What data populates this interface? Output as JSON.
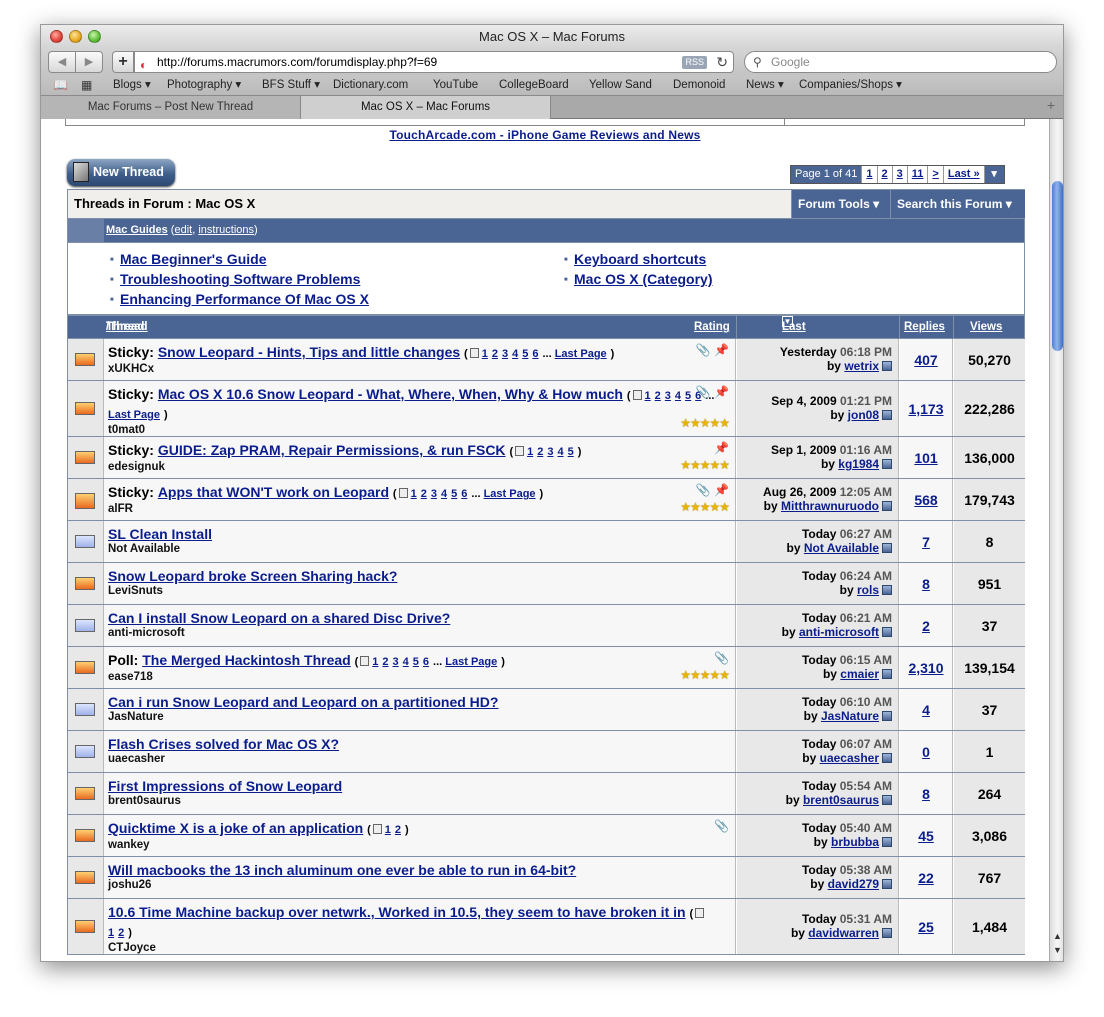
{
  "window": {
    "title": "Mac OS X – Mac Forums"
  },
  "toolbar": {
    "url": "http://forums.macrumors.com/forumdisplay.php?f=69",
    "rss": "RSS",
    "search_placeholder": "Google"
  },
  "bookmarks": [
    "Blogs ▾",
    "Photography ▾",
    "BFS Stuff ▾",
    "Dictionary.com",
    "YouTube",
    "CollegeBoard",
    "Yellow Sand",
    "Demonoid",
    "News ▾",
    "Companies/Shops ▾"
  ],
  "tabs": [
    "Mac Forums – Post New Thread",
    "Mac OS X – Mac Forums"
  ],
  "page": {
    "touch_link": "TouchArcade.com - iPhone Game Reviews and News",
    "new_thread": "New Thread",
    "pager": {
      "label": "Page 1 of 41",
      "pages": [
        "1",
        "2",
        "3",
        "11",
        ">",
        "Last »"
      ]
    },
    "forum_title": "Threads in Forum : Mac OS X",
    "forum_tools": "Forum Tools ▾",
    "search_forum": "Search this Forum ▾",
    "guides": {
      "title": "Mac Guides",
      "edit": "edit",
      "instructions": "instructions",
      "left": [
        "Mac Beginner's Guide",
        "Troubleshooting Software Problems",
        "Enhancing Performance Of Mac OS X"
      ],
      "right": [
        "Keyboard shortcuts",
        "Mac OS X (Category)"
      ]
    },
    "columns": {
      "thread": "Thread",
      "starter": "Thread Starter",
      "rating": "Rating",
      "last_post": "Last Post",
      "replies": "Replies",
      "views": "Views"
    }
  },
  "threads": [
    {
      "prefix": "Sticky:",
      "title": "Snow Leopard - Hints, Tips and little changes",
      "pages": "1 2 3 4 5 6",
      "last_page": "Last Page",
      "starter": "xUKHCx",
      "date": "Yesterday",
      "time": "06:18 PM",
      "by": "wetrix",
      "replies": "407",
      "views": "50,270",
      "icon": "hot",
      "marks": "📎 📌",
      "rating": ""
    },
    {
      "prefix": "Sticky:",
      "title": "Mac OS X 10.6 Snow Leopard - What, Where, When, Why & How much",
      "pages": "1 2 3 4 5 6",
      "last_page": "Last Page",
      "starter": "t0mat0",
      "date": "Sep 4, 2009",
      "time": "01:21 PM",
      "by": "jon08",
      "replies": "1,173",
      "views": "222,286",
      "icon": "hot",
      "marks": "📎 📌",
      "rating": "★★★★★"
    },
    {
      "prefix": "Sticky:",
      "title": "GUIDE: Zap PRAM, Repair Permissions, & run FSCK",
      "pages": "1 2 3 4 5",
      "last_page": "",
      "starter": "edesignuk",
      "date": "Sep 1, 2009",
      "time": "01:16 AM",
      "by": "kg1984",
      "replies": "101",
      "views": "136,000",
      "icon": "hot",
      "marks": "📌",
      "rating": "★★★★★"
    },
    {
      "prefix": "Sticky:",
      "title": "Apps that WON'T work on Leopard",
      "pages": "1 2 3 4 5 6",
      "last_page": "Last Page",
      "starter": "alFR",
      "date": "Aug 26, 2009",
      "time": "12:05 AM",
      "by": "Mitthrawnuruodo",
      "replies": "568",
      "views": "179,743",
      "icon": "lock",
      "marks": "📎 📌",
      "rating": "★★★★★"
    },
    {
      "prefix": "",
      "title": "SL Clean Install",
      "pages": "",
      "last_page": "",
      "starter": "Not Available",
      "date": "Today",
      "time": "06:27 AM",
      "by": "Not Available",
      "replies": "7",
      "views": "8",
      "icon": "cold",
      "marks": "",
      "rating": ""
    },
    {
      "prefix": "",
      "title": "Snow Leopard broke Screen Sharing hack?",
      "pages": "",
      "last_page": "",
      "starter": "LeviSnuts",
      "date": "Today",
      "time": "06:24 AM",
      "by": "rols",
      "replies": "8",
      "views": "951",
      "icon": "hot",
      "marks": "",
      "rating": ""
    },
    {
      "prefix": "",
      "title": "Can I install Snow Leopard on a shared Disc Drive?",
      "pages": "",
      "last_page": "",
      "starter": "anti-microsoft",
      "date": "Today",
      "time": "06:21 AM",
      "by": "anti-microsoft",
      "replies": "2",
      "views": "37",
      "icon": "cold",
      "marks": "",
      "rating": ""
    },
    {
      "prefix": "Poll:",
      "title": "The Merged Hackintosh Thread",
      "pages": "1 2 3 4 5 6",
      "last_page": "Last Page",
      "starter": "ease718",
      "date": "Today",
      "time": "06:15 AM",
      "by": "cmaier",
      "replies": "2,310",
      "views": "139,154",
      "icon": "hot",
      "marks": "📎",
      "rating": "★★★★★"
    },
    {
      "prefix": "",
      "title": "Can i run Snow Leopard and Leopard on a partitioned HD?",
      "pages": "",
      "last_page": "",
      "starter": "JasNature",
      "date": "Today",
      "time": "06:10 AM",
      "by": "JasNature",
      "replies": "4",
      "views": "37",
      "icon": "cold",
      "marks": "",
      "rating": ""
    },
    {
      "prefix": "",
      "title": "Flash Crises solved for Mac OS X?",
      "pages": "",
      "last_page": "",
      "starter": "uaecasher",
      "date": "Today",
      "time": "06:07 AM",
      "by": "uaecasher",
      "replies": "0",
      "views": "1",
      "icon": "cold",
      "marks": "",
      "rating": ""
    },
    {
      "prefix": "",
      "title": "First Impressions of Snow Leopard",
      "pages": "",
      "last_page": "",
      "starter": "brent0saurus",
      "date": "Today",
      "time": "05:54 AM",
      "by": "brent0saurus",
      "replies": "8",
      "views": "264",
      "icon": "hot",
      "marks": "",
      "rating": ""
    },
    {
      "prefix": "",
      "title": "Quicktime X is a joke of an application",
      "pages": "1 2",
      "last_page": "",
      "starter": "wankey",
      "date": "Today",
      "time": "05:40 AM",
      "by": "brbubba",
      "replies": "45",
      "views": "3,086",
      "icon": "hot",
      "marks": "📎",
      "rating": ""
    },
    {
      "prefix": "",
      "title": "Will macbooks the 13 inch aluminum one ever be able to run in 64-bit?",
      "pages": "",
      "last_page": "",
      "starter": "joshu26",
      "date": "Today",
      "time": "05:38 AM",
      "by": "david279",
      "replies": "22",
      "views": "767",
      "icon": "hot",
      "marks": "",
      "rating": ""
    },
    {
      "prefix": "",
      "title": "10.6 Time Machine backup over netwrk., Worked in 10.5, they seem to have broken it in",
      "pages": "1 2",
      "last_page": "",
      "starter": "CTJoyce",
      "date": "Today",
      "time": "05:31 AM",
      "by": "davidwarren",
      "replies": "25",
      "views": "1,484",
      "icon": "hot",
      "marks": "",
      "rating": ""
    }
  ]
}
